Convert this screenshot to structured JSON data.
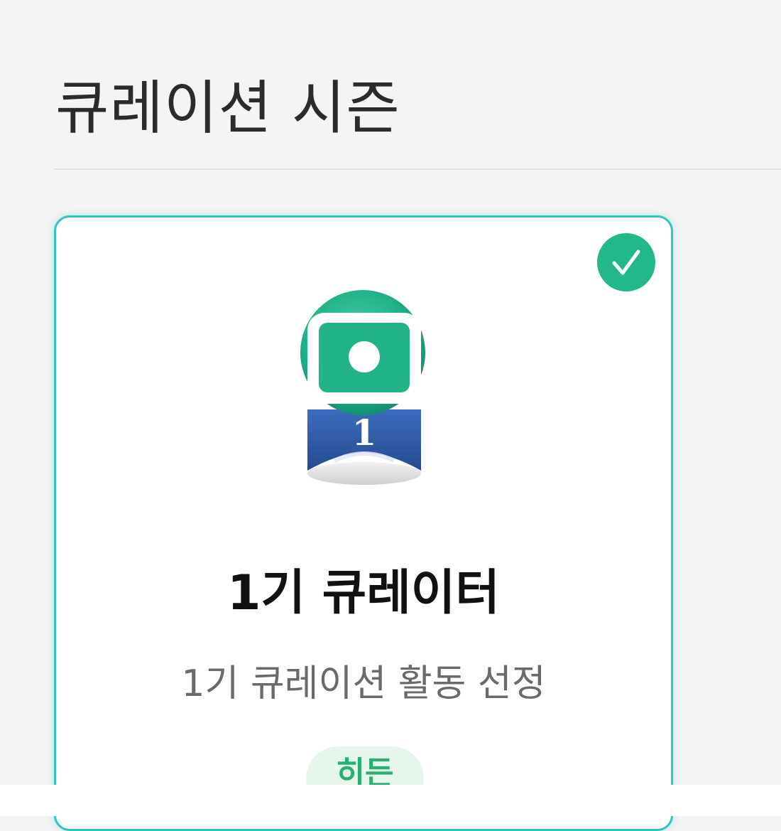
{
  "header": {
    "title": "큐레이션 시즌"
  },
  "season_card": {
    "selected": true,
    "icons": {
      "selected": "check-icon",
      "badge": "curator-medal-icon"
    },
    "badge_number": "1",
    "title": "1기 큐레이터",
    "description": "1기 큐레이션 활동 선정",
    "status_label": "히든"
  },
  "colors": {
    "card_border": "#2fc6c2",
    "check_badge": "#22b98a",
    "medal_green": "#1fb187",
    "ribbon_blue": "#2e5aa8",
    "status_pill_bg": "#e6f6ec",
    "status_pill_text": "#2cae72"
  }
}
